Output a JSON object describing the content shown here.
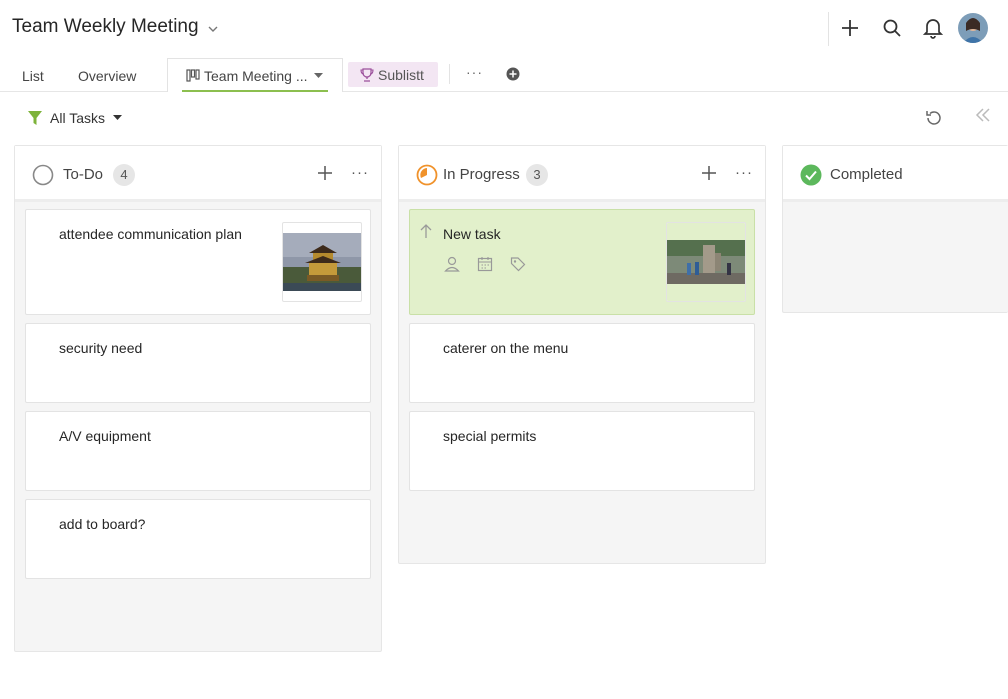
{
  "header": {
    "title": "Team Weekly Meeting"
  },
  "tabs": {
    "list": "List",
    "overview": "Overview",
    "active": "Team Meeting ...",
    "sublist": "Sublistt",
    "more": "···"
  },
  "filter": {
    "label": "All Tasks"
  },
  "columns": [
    {
      "name": "To-Do",
      "count": "4",
      "more": "···",
      "cards": [
        {
          "title": "attendee communication plan"
        },
        {
          "title": "security need"
        },
        {
          "title": "A/V equipment"
        },
        {
          "title": "add to board?"
        }
      ]
    },
    {
      "name": "In Progress",
      "count": "3",
      "more": "···",
      "cards": [
        {
          "title": "New task"
        },
        {
          "title": "caterer on the menu"
        },
        {
          "title": "special permits"
        }
      ]
    },
    {
      "name": "Completed",
      "cards": []
    }
  ],
  "colors": {
    "accent_green": "#8cbf4f",
    "highlight_card": "#e2f0cb",
    "in_progress_orange": "#f0922b",
    "completed_green": "#5cb85c",
    "sublist_bg": "#f3e6f3"
  }
}
